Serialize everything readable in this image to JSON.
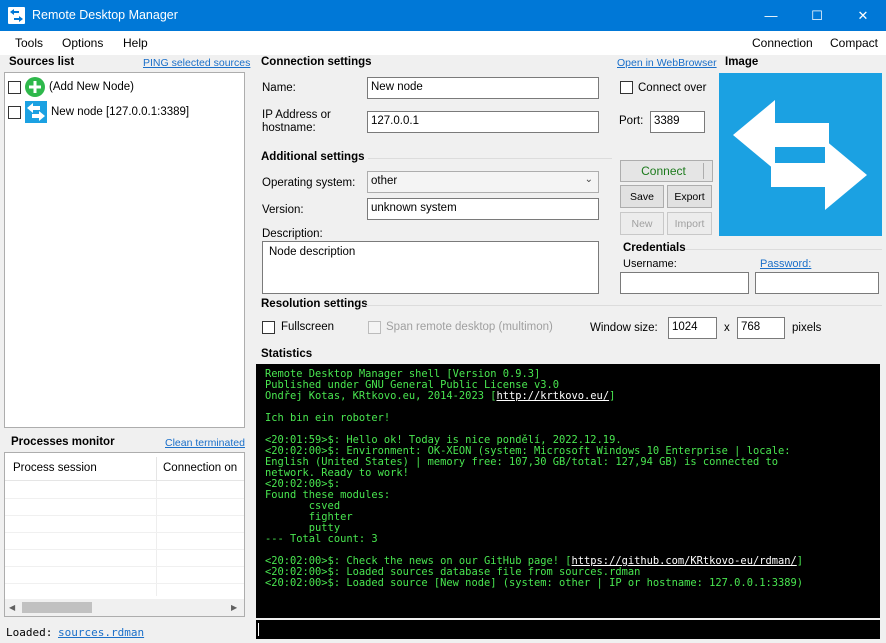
{
  "window": {
    "title": "Remote Desktop Manager",
    "minimize": "—",
    "maximize": "☐",
    "close": "✕"
  },
  "menu": {
    "left": [
      "Tools",
      "Options",
      "Help"
    ],
    "right": [
      "Connection",
      "Compact"
    ]
  },
  "sources": {
    "title": "Sources list",
    "ping_link": "PING selected sources",
    "items": [
      "(Add New Node)",
      "New node [127.0.0.1:3389]"
    ]
  },
  "processes": {
    "title": "Processes monitor",
    "clean_link": "Clean terminated",
    "columns": [
      "Process session",
      "Connection on"
    ]
  },
  "connection": {
    "title": "Connection settings",
    "open_link": "Open in WebBrowser",
    "name_label": "Name:",
    "name_value": "New node",
    "ip_label_1": "IP Address or",
    "ip_label_2": "hostname:",
    "ip_value": "127.0.0.1",
    "connect_over_label": "Connect over",
    "port_label": "Port:",
    "port_value": "3389"
  },
  "image": {
    "title": "Image",
    "accent": "#1ba1e2"
  },
  "additional": {
    "title": "Additional settings",
    "os_label": "Operating system:",
    "os_value": "other",
    "version_label": "Version:",
    "version_value": "unknown system",
    "description_label": "Description:",
    "description_value": "Node description"
  },
  "actions": {
    "connect": "Connect",
    "save": "Save",
    "export": "Export",
    "new": "New",
    "import": "Import"
  },
  "credentials": {
    "title": "Credentials",
    "username_label": "Username:",
    "password_link": "Password:"
  },
  "resolution": {
    "title": "Resolution settings",
    "fullscreen_label": "Fullscreen",
    "span_label": "Span remote desktop (multimon)",
    "window_size_label": "Window size:",
    "width": "1024",
    "x_label": "x",
    "height": "768",
    "pixels_label": "pixels"
  },
  "statistics": {
    "title": "Statistics",
    "console_lines": [
      "Remote Desktop Manager shell [Version 0.9.3]",
      "Published under GNU General Public License v3.0",
      "Ondřej Kotas, KRtkovo.eu, 2014-2023 [http://krtkovo.eu/]",
      "",
      "Ich bin ein roboter!",
      "",
      "<20:01:59>$: Hello ok! Today is nice pondělí, 2022.12.19.",
      "<20:02:00>$: Environment: OK-XEON (system: Microsoft Windows 10 Enterprise | locale:",
      "English (United States) | memory free: 107,30 GB/total: 127,94 GB) is connected to",
      "network. Ready to work!",
      "<20:02:00>$:",
      "Found these modules:",
      "       csved",
      "       fighter",
      "       putty",
      "--- Total count: 3",
      "",
      "<20:02:00>$: Check the news on our GitHub page! [https://github.com/KRtkovo-eu/rdman/]",
      "<20:02:00>$: Loaded sources database file from sources.rdman",
      "<20:02:00>$: Loaded source [New node] (system: other | IP or hostname: 127.0.0.1:3389)"
    ]
  },
  "status": {
    "loaded_label": "Loaded:",
    "loaded_file": "sources.rdman"
  }
}
